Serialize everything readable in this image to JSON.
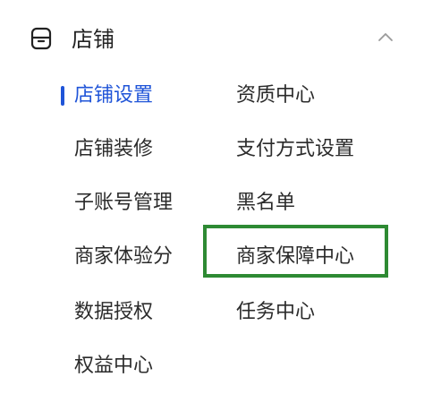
{
  "header": {
    "title": "店铺",
    "left_icon": "store-icon",
    "right_icon": "chevron-up-icon"
  },
  "menu": {
    "left": [
      {
        "label": "店铺设置",
        "active": true
      },
      {
        "label": "店铺装修"
      },
      {
        "label": "子账号管理"
      },
      {
        "label": "商家体验分"
      },
      {
        "label": "数据授权"
      },
      {
        "label": "权益中心"
      }
    ],
    "right": [
      {
        "label": "资质中心"
      },
      {
        "label": "支付方式设置"
      },
      {
        "label": "黑名单"
      },
      {
        "label": "商家保障中心",
        "highlighted": true
      },
      {
        "label": "任务中心"
      }
    ]
  },
  "colors": {
    "active": "#1f54d8",
    "text": "#2b2b2b",
    "highlight": "#2e8a33"
  }
}
